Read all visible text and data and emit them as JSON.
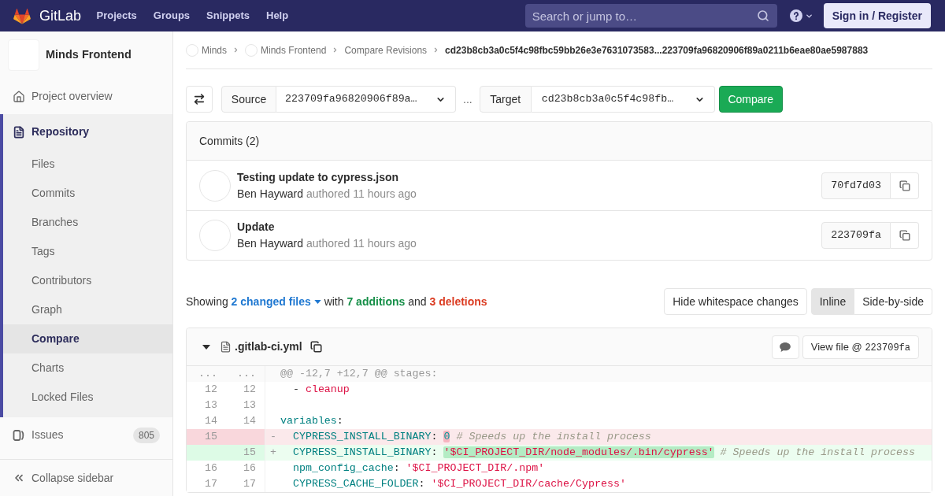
{
  "navbar": {
    "logo_text": "GitLab",
    "links": [
      "Projects",
      "Groups",
      "Snippets",
      "Help"
    ],
    "search": {
      "placeholder": "Search or jump to…"
    },
    "sign_in": "Sign in / Register"
  },
  "sidebar": {
    "project_name": "Minds Frontend",
    "items": [
      {
        "label": "Project overview",
        "selected": false
      },
      {
        "label": "Repository",
        "selected": true,
        "children": [
          {
            "label": "Files",
            "selected": false
          },
          {
            "label": "Commits",
            "selected": false
          },
          {
            "label": "Branches",
            "selected": false
          },
          {
            "label": "Tags",
            "selected": false
          },
          {
            "label": "Contributors",
            "selected": false
          },
          {
            "label": "Graph",
            "selected": false
          },
          {
            "label": "Compare",
            "selected": true
          },
          {
            "label": "Charts",
            "selected": false
          },
          {
            "label": "Locked Files",
            "selected": false
          }
        ]
      },
      {
        "label": "Issues",
        "selected": false,
        "count": "805"
      }
    ],
    "collapse": "Collapse sidebar"
  },
  "breadcrumbs": [
    {
      "label": "Minds",
      "kind": "group"
    },
    {
      "label": "Minds Frontend",
      "kind": "project"
    },
    {
      "label": "Compare Revisions",
      "kind": "page"
    },
    {
      "label": "cd23b8cb3a0c5f4c98fbc59bb26e3e7631073583...223709fa96820906f89a0211b6eae80ae5987883",
      "kind": "current"
    }
  ],
  "compare_form": {
    "source": {
      "label": "Source",
      "value": "223709fa96820906f89a…"
    },
    "separator": "...",
    "target": {
      "label": "Target",
      "value": "cd23b8cb3a0c5f4c98fb…"
    },
    "button": "Compare"
  },
  "commits": {
    "title": "Commits (2)",
    "items": [
      {
        "title": "Testing update to cypress.json",
        "author": "Ben Hayward",
        "meta": "authored 11 hours ago",
        "sha": "70fd7d03"
      },
      {
        "title": "Update",
        "author": "Ben Hayward",
        "meta": "authored 11 hours ago",
        "sha": "223709fa"
      }
    ]
  },
  "diff_summary": {
    "showing": "Showing",
    "changed_files": "2 changed files",
    "with": "with",
    "additions": "7 additions",
    "and": "and",
    "deletions": "3 deletions"
  },
  "diff_controls": {
    "whitespace_button": "Hide whitespace changes",
    "view_modes": [
      {
        "label": "Inline",
        "selected": true
      },
      {
        "label": "Side-by-side",
        "selected": false
      }
    ]
  },
  "file": {
    "name": ".gitlab-ci.yml",
    "expanded": true,
    "view_file": "View file @",
    "sha": "223709fa",
    "lines": [
      {
        "kind": "match",
        "old": "...",
        "new": "...",
        "text": "@@ -12,7 +12,7 @@ stages:"
      },
      {
        "kind": "context",
        "old": "12",
        "new": "12",
        "tokens": [
          {
            "text": "  - ",
            "kind": "plain"
          },
          {
            "text": "cleanup",
            "kind": "string"
          }
        ]
      },
      {
        "kind": "context",
        "old": "13",
        "new": "13"
      },
      {
        "kind": "context",
        "old": "14",
        "new": "14",
        "tokens": [
          {
            "text": "variables",
            "kind": "key"
          },
          {
            "text": ":",
            "kind": "plain"
          }
        ]
      },
      {
        "kind": "old",
        "old": "15",
        "marker": "-",
        "tokens": [
          {
            "text": "  CYPRESS_INSTALL_BINARY",
            "kind": "key",
            "highlighted": false
          },
          {
            "text": ": ",
            "kind": "plain",
            "highlighted": false
          },
          {
            "text": "0",
            "kind": "number",
            "highlighted": true
          },
          {
            "text": " # Speeds up the install process",
            "kind": "comment",
            "highlighted": false
          }
        ]
      },
      {
        "kind": "new",
        "new": "15",
        "marker": "+",
        "tokens": [
          {
            "text": "  CYPRESS_INSTALL_BINARY",
            "kind": "key",
            "highlighted": false
          },
          {
            "text": ": ",
            "kind": "plain",
            "highlighted": false
          },
          {
            "text": "'$CI_PROJECT_DIR/node_modules/.bin/cypress'",
            "kind": "string",
            "highlighted": true
          },
          {
            "text": " # Speeds up the install process",
            "kind": "comment",
            "highlighted": false
          }
        ]
      },
      {
        "kind": "context",
        "old": "16",
        "new": "16",
        "tokens": [
          {
            "text": "  npm_config_cache",
            "kind": "key"
          },
          {
            "text": ": ",
            "kind": "plain"
          },
          {
            "text": "'$CI_PROJECT_DIR/.npm'",
            "kind": "string"
          }
        ]
      },
      {
        "kind": "context",
        "old": "17",
        "new": "17",
        "tokens": [
          {
            "text": "  CYPRESS_CACHE_FOLDER",
            "kind": "key"
          },
          {
            "text": ": ",
            "kind": "plain"
          },
          {
            "text": "'$CI_PROJECT_DIR/cache/Cypress'",
            "kind": "string"
          }
        ]
      }
    ]
  }
}
